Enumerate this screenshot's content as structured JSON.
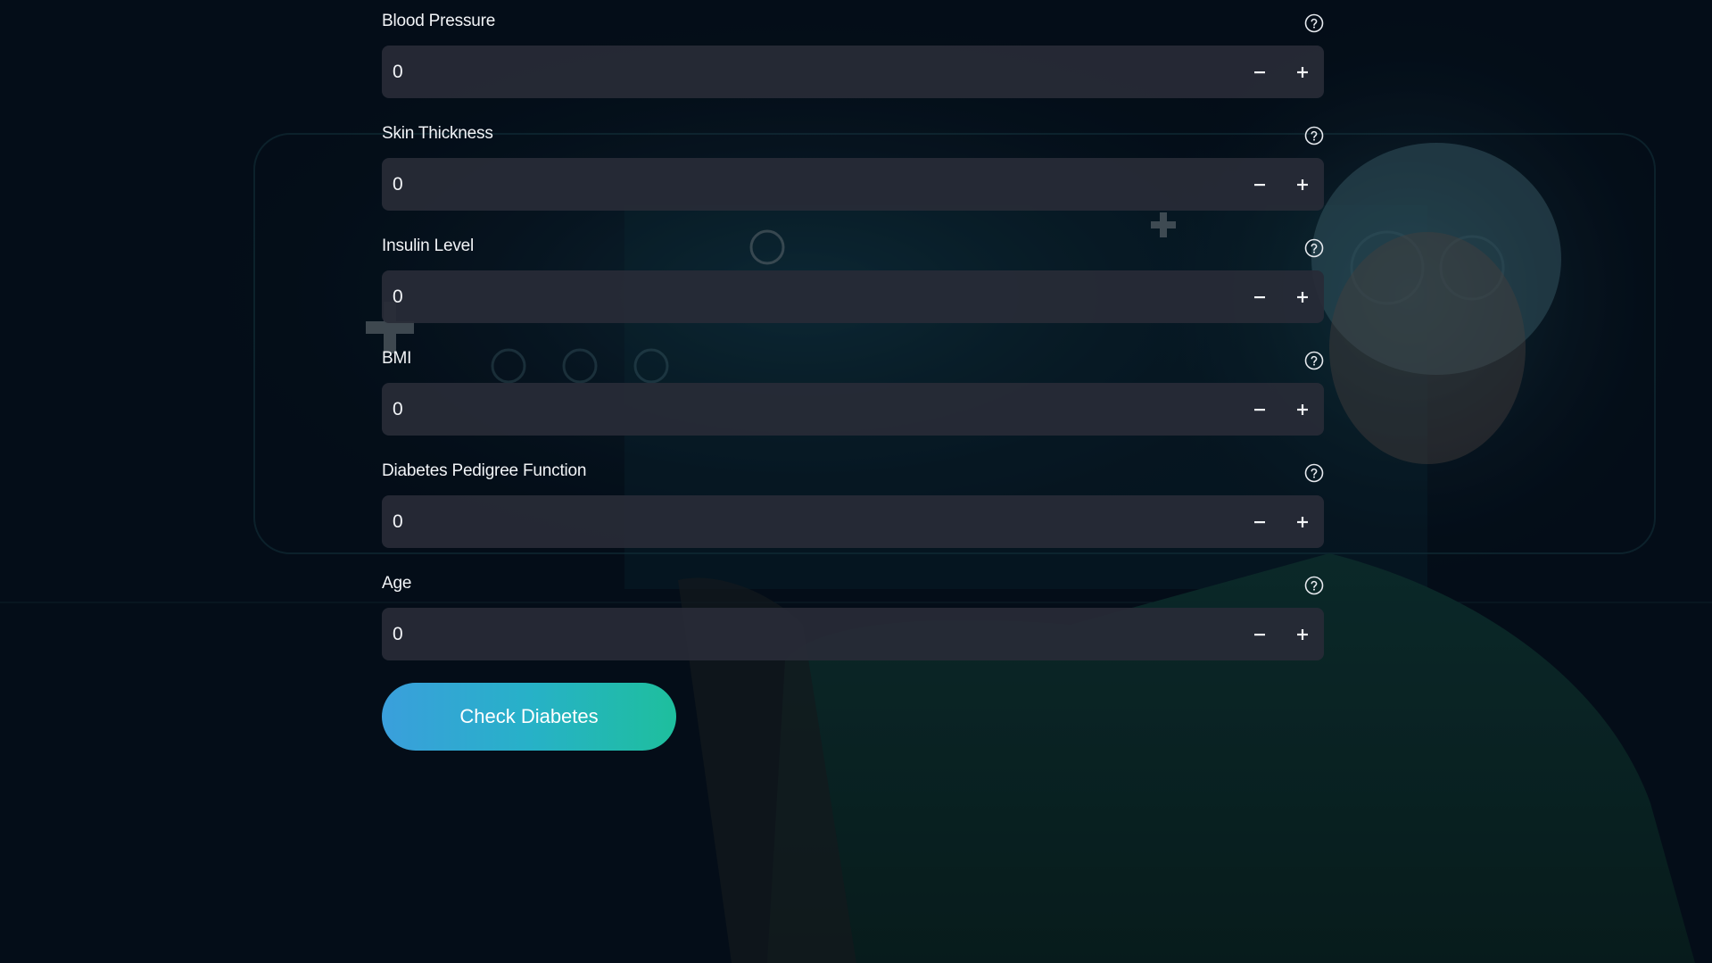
{
  "form": {
    "fields": [
      {
        "label": "Blood Pressure",
        "value": "0"
      },
      {
        "label": "Skin Thickness",
        "value": "0"
      },
      {
        "label": "Insulin Level",
        "value": "0"
      },
      {
        "label": "BMI",
        "value": "0"
      },
      {
        "label": "Diabetes Pedigree Function",
        "value": "0"
      },
      {
        "label": "Age",
        "value": "0"
      }
    ],
    "submit_label": "Check Diabetes"
  },
  "icons": {
    "help": "help-circle-icon",
    "decrement": "minus-icon",
    "increment": "plus-icon"
  },
  "colors": {
    "background": "#05101c",
    "input_background": "#282b37",
    "text": "#f2f4f7",
    "button_gradient_start": "#3a9fdc",
    "button_gradient_end": "#1ebf9d"
  }
}
